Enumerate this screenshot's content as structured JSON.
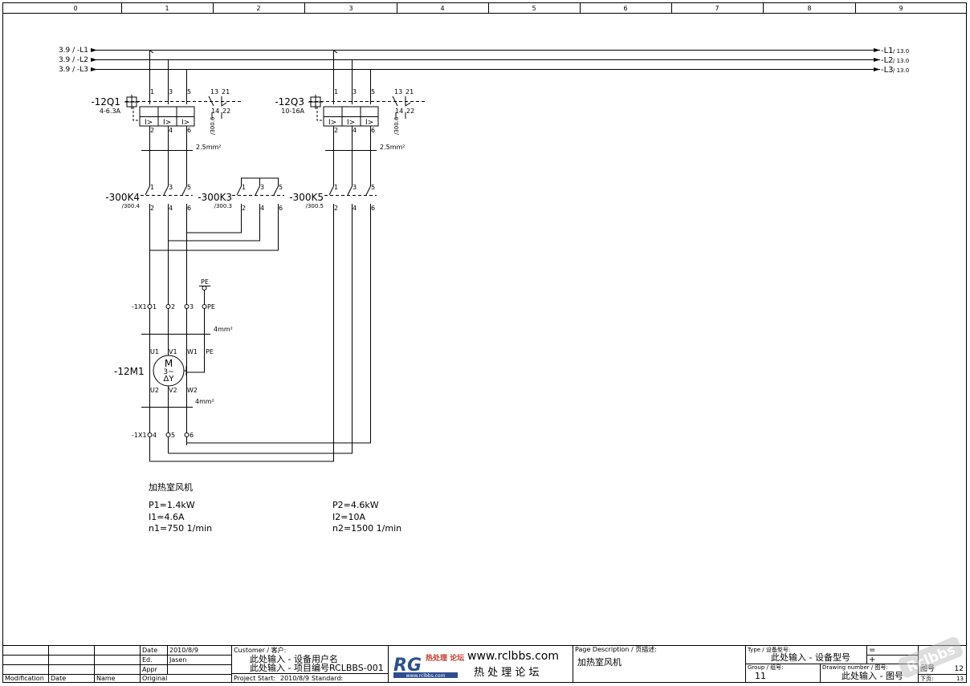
{
  "columns": [
    "0",
    "1",
    "2",
    "3",
    "4",
    "5",
    "6",
    "7",
    "8",
    "9"
  ],
  "supply": {
    "left_refs": [
      "3.9 / -L1",
      "3.9 / -L2",
      "3.9 / -L3"
    ],
    "right_refs": [
      "-L1",
      "-L2",
      "-L3"
    ],
    "right_page": "13.0"
  },
  "breakers": [
    {
      "tag": "-12Q1",
      "range": "4-6.3A",
      "aux_ref": "/300.6",
      "wire": "2.5mm²"
    },
    {
      "tag": "-12Q3",
      "range": "10-16A",
      "aux_ref": "/300.6",
      "wire": "2.5mm²"
    }
  ],
  "pole_labels": {
    "in": [
      "1",
      "3",
      "5"
    ],
    "out": [
      "2",
      "4",
      "6"
    ],
    "aux_top": [
      "13",
      "21"
    ],
    "aux_bot": [
      "14",
      "22"
    ],
    "trip": "I>"
  },
  "contactors": [
    {
      "tag": "-300K4",
      "ref": "/300.4"
    },
    {
      "tag": "-300K3",
      "ref": "/300.3"
    },
    {
      "tag": "-300K5",
      "ref": "/300.5"
    }
  ],
  "terminals": {
    "strip": "-1X1",
    "top": [
      "1",
      "2",
      "3",
      "PE"
    ],
    "bottom": [
      "4",
      "5",
      "6"
    ],
    "pe_label": "PE"
  },
  "motor": {
    "tag": "-12M1",
    "symbol": "M",
    "phase": "3~",
    "winding": "ΔΥ",
    "top_terms": [
      "U1",
      "V1",
      "W1",
      "PE"
    ],
    "bottom_terms": [
      "U2",
      "V2",
      "W2"
    ],
    "wire_top": "4mm²",
    "wire_bottom": "4mm²"
  },
  "notes": {
    "title": "加热室风机",
    "speed1": [
      "P1=1.4kW",
      "I1=4.6A",
      "n1=750  1/min"
    ],
    "speed2": [
      "P2=4.6kW",
      "I2=10A",
      "n2=1500  1/min"
    ]
  },
  "title_block": {
    "date_label": "Date",
    "date_value": "2010/8/9",
    "ed_label": "Ed.",
    "ed_value": "Jasen",
    "appr_label": "Appr",
    "original_label": "Original",
    "modification_label": "Modification",
    "date_col_label": "Date",
    "name_label": "Name",
    "customer_label": "Customer / 客户:",
    "customer_line1": "此处输入 - 设备用户名",
    "customer_line2": "此处输入 - 项目编号RCLBBS-001",
    "project_start_label": "Project Start:",
    "project_start_value": "2010/8/9",
    "standard_label": "Standard:",
    "logo_big": "RG",
    "logo_cn": "热处理 论坛",
    "logo_url_small": "www.rclbbs.com",
    "site_url": "www.rclbbs.com",
    "site_cn": "热 处 理 论 坛",
    "page_desc_label": "Page Description / 页描述:",
    "page_desc_value": "加热室风机",
    "type_label": "Type / 设备型号:",
    "type_value": "此处输入 - 设备型号",
    "group_label": "Group / 组号:",
    "group_value": "11",
    "drawing_label": "Drawing number / 图号:",
    "drawing_value": "此处输入 - 图号",
    "eq_sign": "=",
    "plus_sign": "+",
    "page_label": "图号",
    "page_value": "12",
    "next_label": "下页:",
    "next_value": "13",
    "watermark": "Rclbbs"
  }
}
